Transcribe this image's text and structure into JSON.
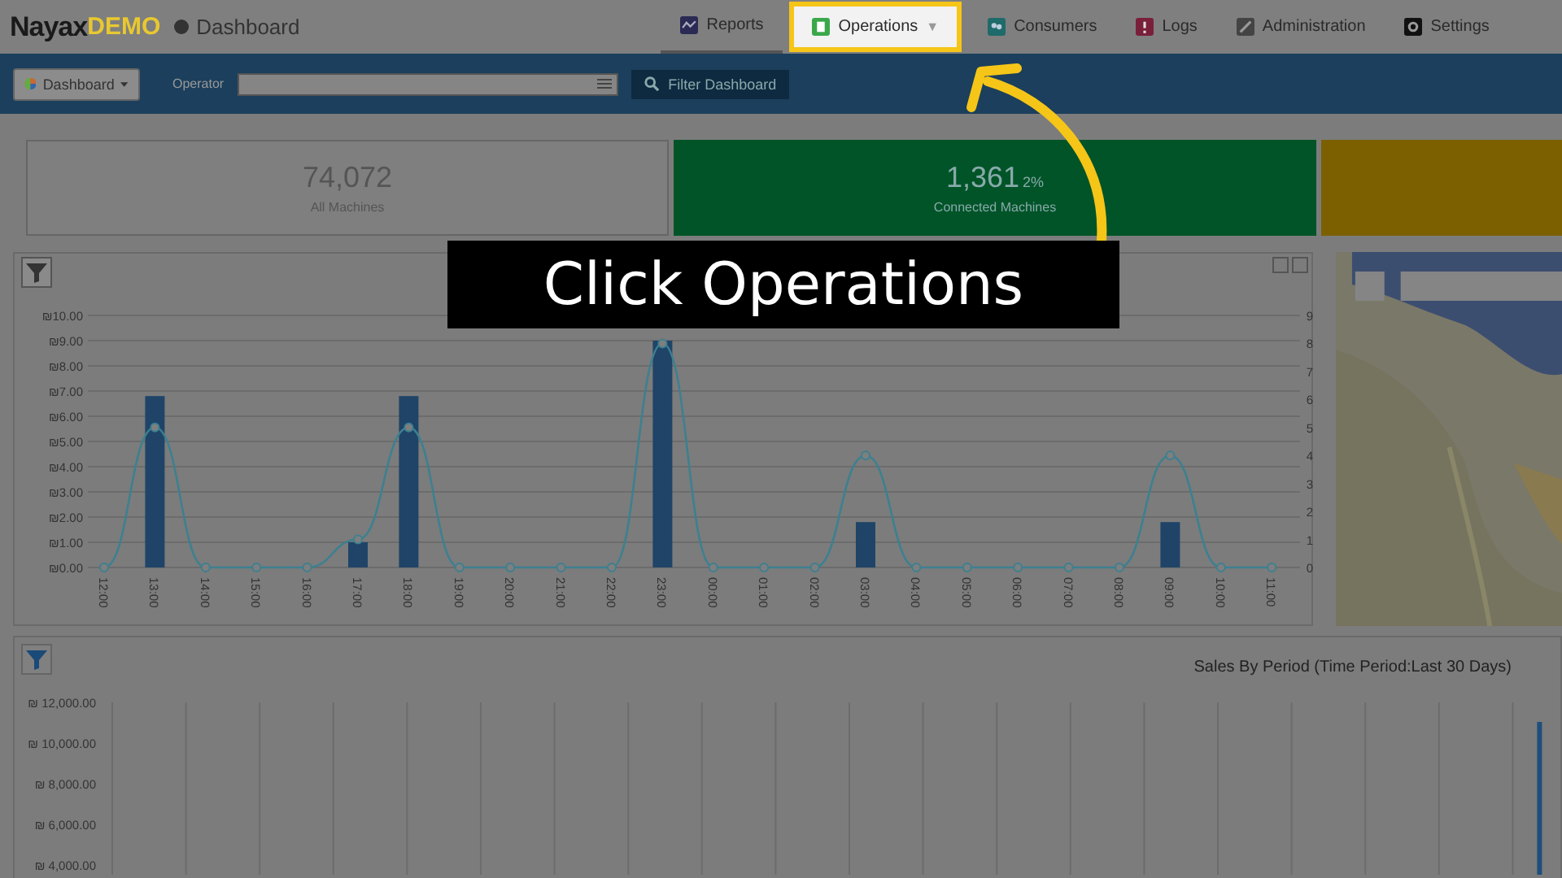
{
  "header": {
    "logo": "Nayax",
    "logo_suffix": "DEMO",
    "page": "Dashboard"
  },
  "nav": [
    {
      "label": "Reports",
      "selected": true,
      "highlighted": false
    },
    {
      "label": "Operations",
      "selected": false,
      "highlighted": true,
      "caret": "▼"
    },
    {
      "label": "Consumers",
      "selected": false,
      "highlighted": false
    },
    {
      "label": "Logs",
      "selected": false,
      "highlighted": false
    },
    {
      "label": "Administration",
      "selected": false,
      "highlighted": false
    },
    {
      "label": "Settings",
      "selected": false,
      "highlighted": false
    }
  ],
  "toolbar": {
    "dashboard_select": "Dashboard",
    "operator_label": "Operator",
    "filter_button": "Filter Dashboard"
  },
  "kpis": [
    {
      "value": "74,072",
      "label": "All Machines",
      "kind": "plain"
    },
    {
      "value": "1,361",
      "percent": "2%",
      "label": "Connected Machines",
      "kind": "green"
    },
    {
      "kind": "amber"
    }
  ],
  "hourly_chart": {
    "chart_data": {
      "type": "bar",
      "grid": true,
      "categories": [
        "12:00",
        "13:00",
        "14:00",
        "15:00",
        "16:00",
        "17:00",
        "18:00",
        "19:00",
        "20:00",
        "21:00",
        "22:00",
        "23:00",
        "00:00",
        "01:00",
        "02:00",
        "03:00",
        "04:00",
        "05:00",
        "06:00",
        "07:00",
        "08:00",
        "09:00",
        "10:00",
        "11:00"
      ],
      "ylim": [
        0,
        10
      ],
      "y2lim": [
        0,
        9
      ],
      "yticks": [
        {
          "value": 0,
          "label": "₪0.00"
        },
        {
          "value": 1,
          "label": "₪1.00"
        },
        {
          "value": 2,
          "label": "₪2.00"
        },
        {
          "value": 3,
          "label": "₪3.00"
        },
        {
          "value": 4,
          "label": "₪4.00"
        },
        {
          "value": 5,
          "label": "₪5.00"
        },
        {
          "value": 6,
          "label": "₪6.00"
        },
        {
          "value": 7,
          "label": "₪7.00"
        },
        {
          "value": 8,
          "label": "₪8.00"
        },
        {
          "value": 9,
          "label": "₪9.00"
        },
        {
          "value": 10,
          "label": "₪10.00"
        }
      ],
      "y2ticks": [
        0,
        1,
        2,
        3,
        4,
        5,
        6,
        7,
        8,
        9
      ],
      "series": [
        {
          "type": "bar",
          "color": "#1f4468",
          "values": [
            0,
            6.8,
            0,
            0,
            0,
            1,
            6.8,
            0,
            0,
            0,
            0,
            9,
            0,
            0,
            0,
            1.8,
            0,
            0,
            0,
            0,
            0,
            1.8,
            0,
            0
          ]
        },
        {
          "type": "line",
          "axis": "y2",
          "marker": "o",
          "color": "#3d8090",
          "values": [
            0,
            5,
            0,
            0,
            0,
            1,
            5,
            0,
            0,
            0,
            0,
            8,
            0,
            0,
            0,
            4,
            0,
            0,
            0,
            0,
            0,
            4,
            0,
            0
          ]
        }
      ]
    }
  },
  "sales_chart": {
    "title": "Sales By Period (Time Period:Last 30 Days)",
    "axis_labels": [
      "₪ 12,000.00",
      "₪ 10,000.00",
      "₪ 8,000.00",
      "₪ 6,000.00",
      "₪ 4,000.00"
    ]
  },
  "callout": {
    "text": "Click Operations"
  }
}
